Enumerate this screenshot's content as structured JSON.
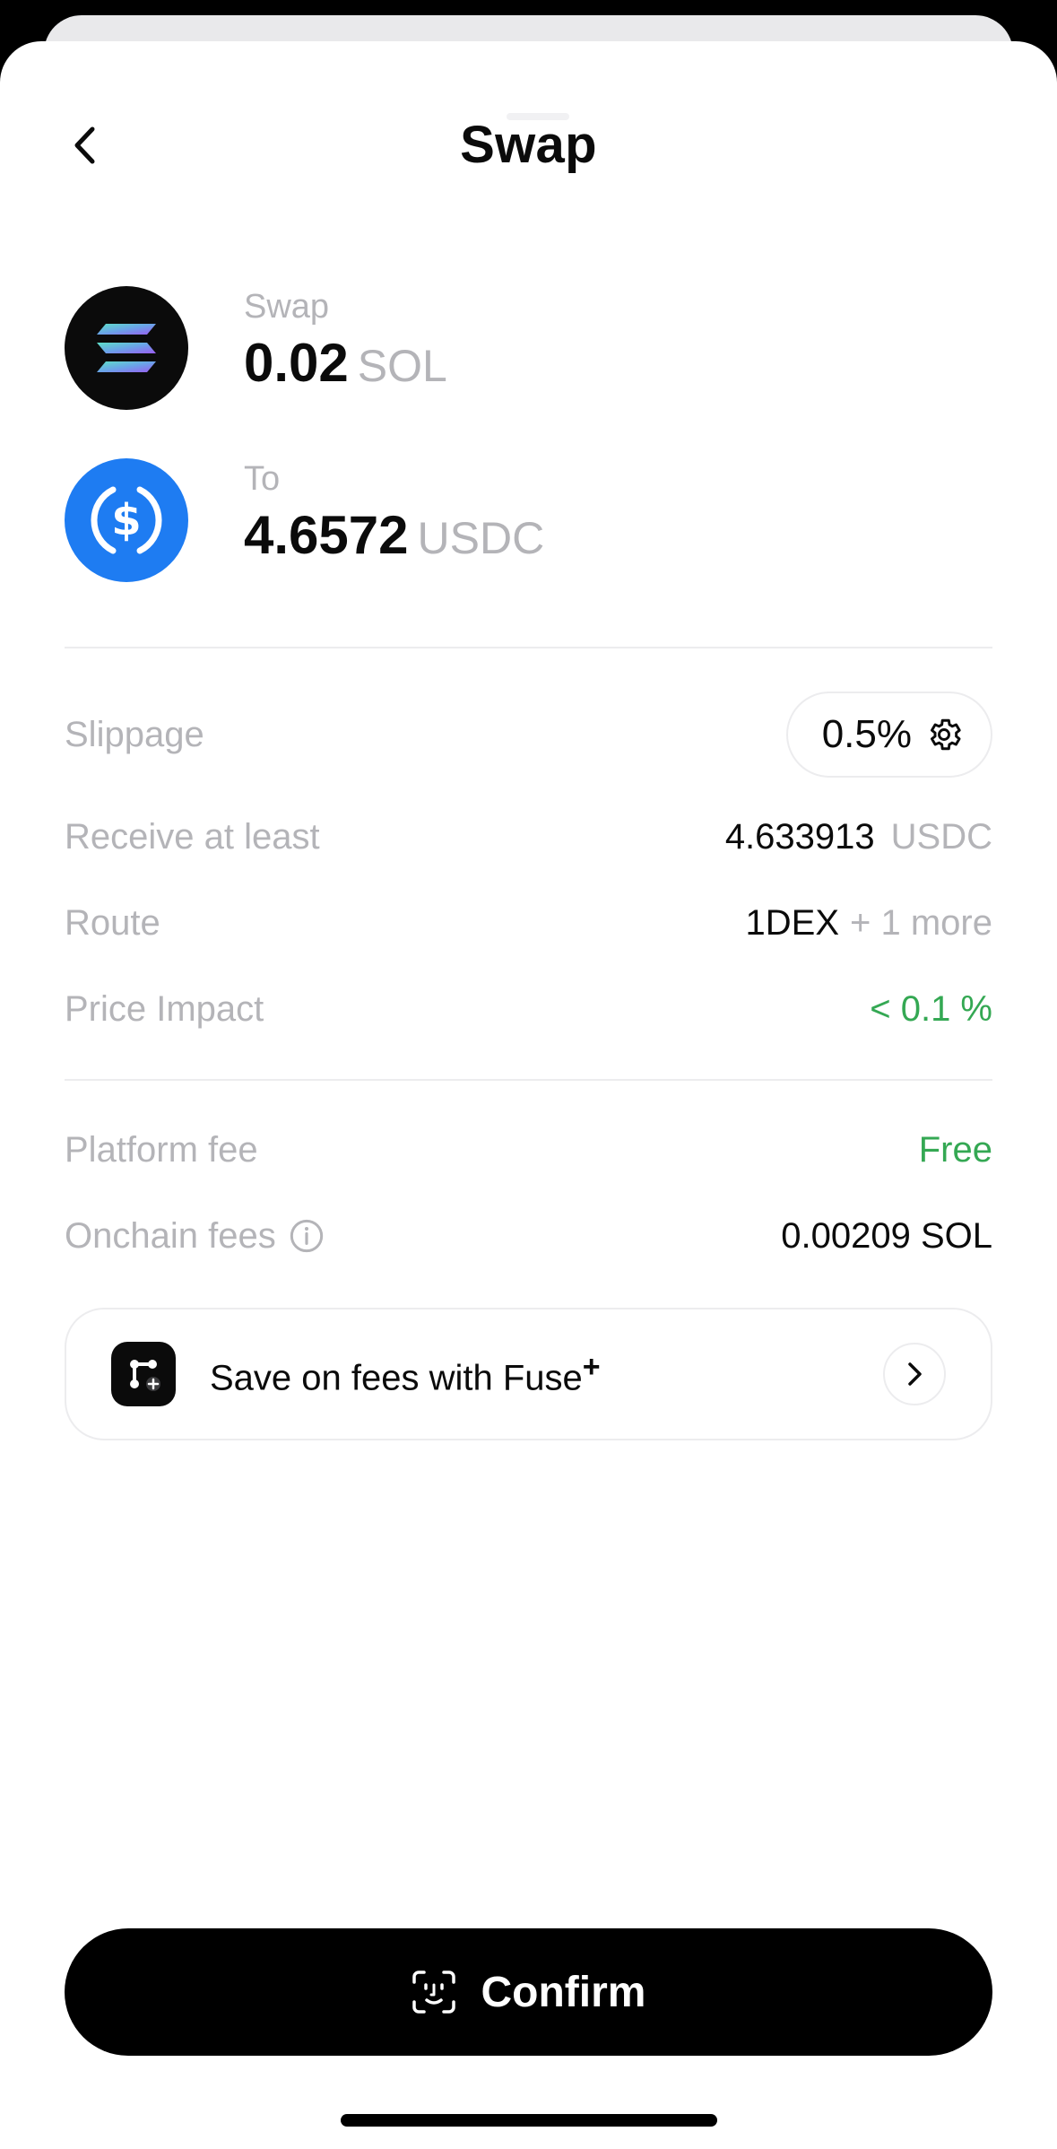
{
  "header": {
    "title": "Swap"
  },
  "from": {
    "caption": "Swap",
    "amount": "0.02",
    "symbol": "SOL"
  },
  "to": {
    "caption": "To",
    "amount": "4.6572",
    "symbol": "USDC"
  },
  "details": {
    "slippage": {
      "label": "Slippage",
      "value": "0.5%"
    },
    "receive": {
      "label": "Receive at least",
      "amount": "4.633913",
      "symbol": "USDC"
    },
    "route": {
      "label": "Route",
      "value": "1DEX",
      "more": "+ 1 more"
    },
    "price_impact": {
      "label": "Price Impact",
      "value": "< 0.1 %"
    }
  },
  "fees": {
    "platform": {
      "label": "Platform fee",
      "value": "Free"
    },
    "onchain": {
      "label": "Onchain fees",
      "value": "0.00209 SOL"
    }
  },
  "promo": {
    "text": "Save on fees with Fuse",
    "superscript": "+"
  },
  "confirm_label": "Confirm",
  "colors": {
    "green": "#34a853",
    "usdc_blue": "#1e7cf2",
    "sol_bg": "#0b0b0b",
    "border": "#ececee",
    "muted": "#b4b4b8"
  },
  "icons": [
    "chevron-left-icon",
    "solana-icon",
    "usdc-icon",
    "gear-icon",
    "info-icon",
    "fuse-logo-icon",
    "chevron-right-icon",
    "face-id-icon"
  ]
}
